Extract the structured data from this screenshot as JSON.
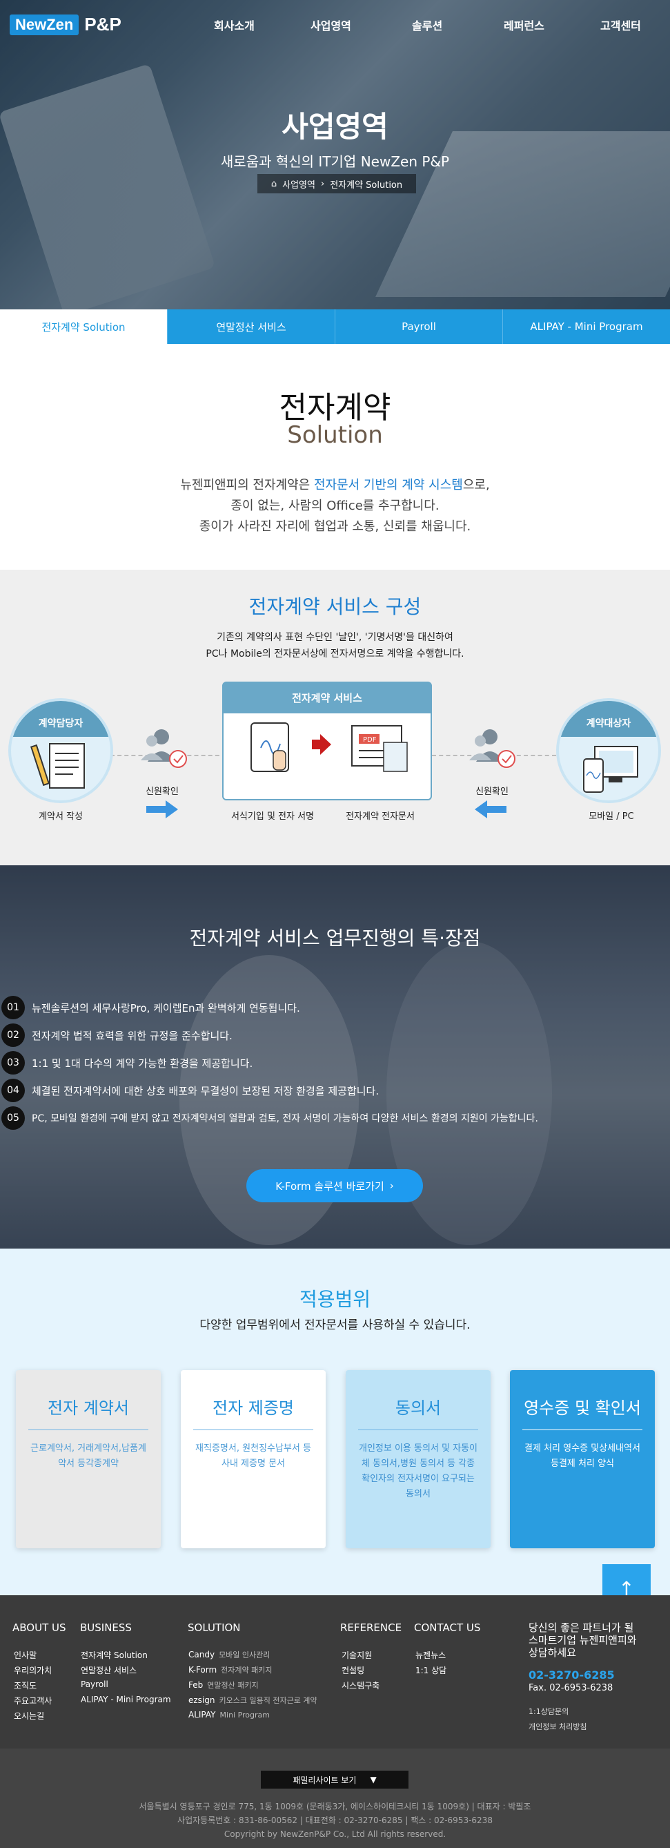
{
  "brand": {
    "logo_main": "NewZen",
    "logo_sub": "P&P"
  },
  "nav": [
    "회사소개",
    "사업영역",
    "솔루션",
    "레퍼런스",
    "고객센터"
  ],
  "hero": {
    "title": "사업영역",
    "subtitle": "새로움과 혁신의 IT기업 NewZen P&P",
    "breadcrumb": [
      "사업영역",
      "전자계약 Solution"
    ]
  },
  "tabs": [
    {
      "label": "전자계약 Solution",
      "active": true
    },
    {
      "label": "연말정산 서비스",
      "active": false
    },
    {
      "label": "Payroll",
      "active": false
    },
    {
      "label": "ALIPAY - Mini Program",
      "active": false
    }
  ],
  "intro": {
    "title": "전자계약",
    "subtitle": "Solution",
    "line1_pre": "뉴젠피앤피의 전자계약은 ",
    "line1_hl": "전자문서 기반의 계약 시스템",
    "line1_post": "으로,",
    "line2": "종이 없는, 사람의 Office를 추구합니다.",
    "line3": "종이가 사라진 자리에 협업과 소통, 신뢰를 채웁니다."
  },
  "composition": {
    "title": "전자계약 서비스 구성",
    "desc1": "기존의 계약의사 표현 수단인 '날인', '기명서명'을 대신하여",
    "desc2": "PC나 Mobile의 전자문서상에 전자서명으로 계약을 수행합니다.",
    "left_circle": "계약담당자",
    "left_label": "계약서 작성",
    "left_verify": "신원확인",
    "center_title": "전자계약 서비스",
    "center_label1": "서식기입 및 전자 서명",
    "center_label2": "전자계약 전자문서",
    "pdf_tag": "PDF",
    "right_verify": "신원확인",
    "right_circle": "계약대상자",
    "right_label": "모바일 / PC"
  },
  "features": {
    "title": "전자계약 서비스 업무진행의 특·장점",
    "items": [
      {
        "num": "01",
        "text": "뉴젠솔루션의 세무사랑Pro, 케이렙En과 완벽하게 연동됩니다."
      },
      {
        "num": "02",
        "text": "전자계약 법적 효력을 위한 규정을 준수합니다."
      },
      {
        "num": "03",
        "text": "1:1 및 1대 다수의 계약 가능한 환경을 제공합니다."
      },
      {
        "num": "04",
        "text": "체결된 전자계약서에 대한 상호 배포와 무결성이 보장된 저장 환경을 제공합니다."
      },
      {
        "num": "05",
        "text": "PC, 모바일 환경에 구애 받지 않고 전자계약서의 열람과 검토, 전자 서명이 가능하여 다양한 서비스 환경의 지원이 가능합니다."
      }
    ],
    "button": "K-Form 솔루션 바로가기"
  },
  "scope": {
    "title": "적용범위",
    "subtitle": "다양한 업무범위에서 전자문서를 사용하실 수 있습니다.",
    "cards": [
      {
        "title": "전자 계약서",
        "desc": "근로계약서, 거래계약서,납품계약서 등각종계약"
      },
      {
        "title": "전자 제증명",
        "desc": "재직증명서, 원천징수납부서 등사내 제증명 문서"
      },
      {
        "title": "동의서",
        "desc": "개인정보 이용 동의서 및 자동이체 동의서,병원 동의서 등 각종 확인자의 전자서명이 요구되는 동의서"
      },
      {
        "title": "영수증 및 확인서",
        "desc": "결제 처리 영수증 및상세내역서 등결제 처리 양식"
      }
    ]
  },
  "footer": {
    "about": {
      "title": "ABOUT US",
      "items": [
        "인사말",
        "우리의가치",
        "조직도",
        "주요고객사",
        "오시는길"
      ]
    },
    "business": {
      "title": "BUSINESS",
      "items": [
        "전자계약 Solution",
        "연말정산 서비스",
        "Payroll",
        "ALIPAY - Mini Program"
      ]
    },
    "solution": {
      "title": "SOLUTION",
      "items": [
        {
          "name": "Candy",
          "desc": "모바일 인사관리"
        },
        {
          "name": "K-Form",
          "desc": "전자계약 패키지"
        },
        {
          "name": "Feb",
          "desc": "연말정산 패키지"
        },
        {
          "name": "ezsign",
          "desc": "키오스크 일용직 전자근로 계약"
        },
        {
          "name": "ALIPAY",
          "desc": "Mini Program"
        }
      ]
    },
    "reference": {
      "title": "REFERENCE",
      "items": [
        "기술지원",
        "컨설팅",
        "시스템구축"
      ]
    },
    "contact": {
      "title": "CONTACT US",
      "items": [
        "뉴젠뉴스",
        "1:1 상담"
      ]
    },
    "cta": {
      "line1": "당신의 좋은 파트너가 될",
      "line2": "스마트기업 뉴젠피앤피와",
      "line3": "상담하세요",
      "phone": "02-3270-6285",
      "fax": "Fax. 02-6953-6238",
      "link1": "1:1상담문의",
      "link2": "개인정보 처리방침"
    },
    "family_site": "패밀리사이트 보기",
    "address": "서울특별시 영등포구 경인로 775, 1동 1009호 (문래동3가, 에이스하이테크시티 1동 1009호)  |  대표자 : 박필조",
    "biz": "사업자등록번호 : 831-86-00562  |  대표전화 : 02-3270-6285  |  팩스 : 02-6953-6238",
    "copyright": "Copyright by NewZenP&P Co., Ltd All rights reserved."
  },
  "colors": {
    "primary": "#1e9bdf",
    "footer": "#3b3b3b",
    "scope_bg": "#e5f4fd"
  }
}
